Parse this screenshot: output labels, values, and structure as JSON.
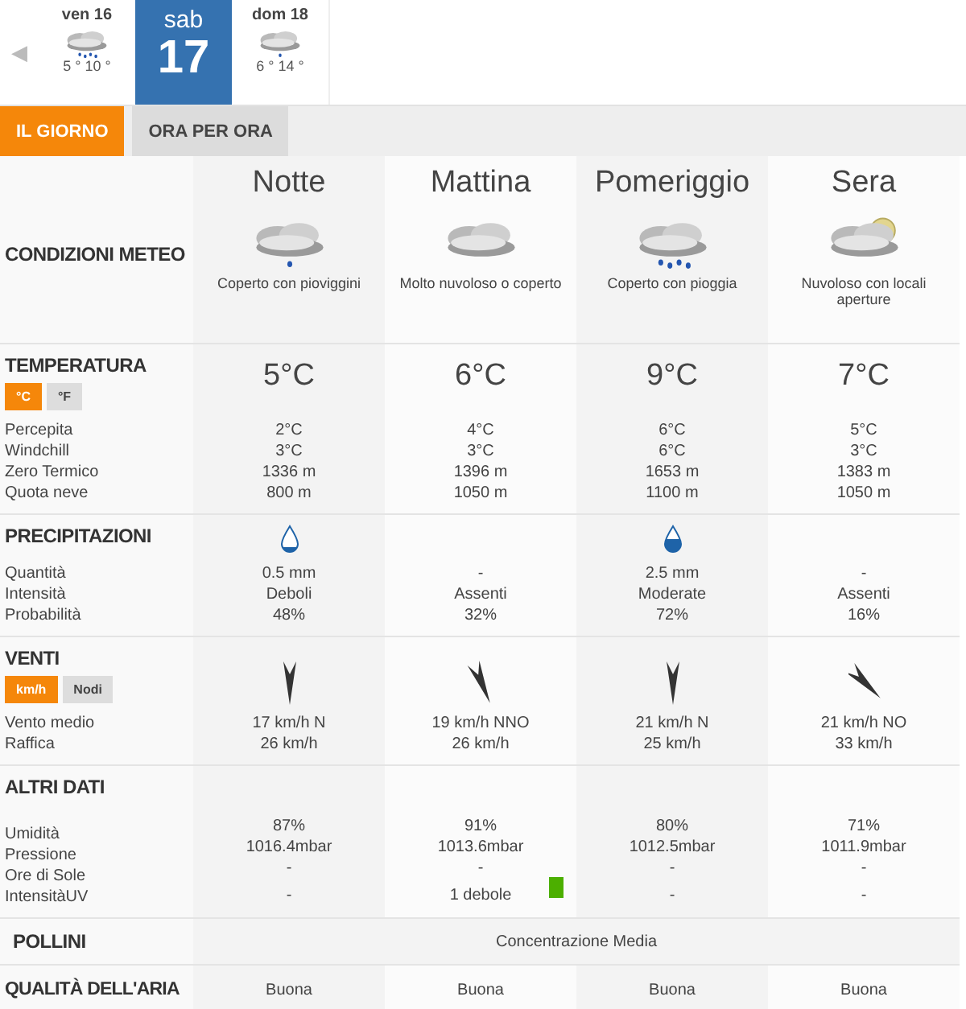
{
  "days": [
    {
      "weekday": "ven 16",
      "kind": "rain",
      "temps": "5 ° 10 °",
      "selected": false
    },
    {
      "weekday": "sab",
      "day": "17",
      "kind": "none",
      "selected": true
    },
    {
      "weekday": "dom 18",
      "kind": "drizzle",
      "temps": "6 ° 14 °",
      "selected": false
    }
  ],
  "prev_arrow": "◀",
  "tabs": [
    {
      "label": "IL GIORNO",
      "selected": true
    },
    {
      "label": "ORA PER ORA",
      "selected": false
    }
  ],
  "conditions": {
    "title": "CONDIZIONI METEO",
    "periods": [
      {
        "name": "Notte",
        "kind": "drizzle",
        "text": "Coperto con pioviggini"
      },
      {
        "name": "Mattina",
        "kind": "cloudy",
        "text": "Molto nuvoloso o coperto"
      },
      {
        "name": "Pomeriggio",
        "kind": "rain",
        "text": "Coperto con pioggia"
      },
      {
        "name": "Sera",
        "kind": "partly_sunny",
        "text": "Nuvoloso con locali aperture"
      }
    ]
  },
  "sections": [
    {
      "kind": "temperature",
      "title": "TEMPERATURA",
      "units": [
        {
          "label": "°C",
          "selected": true
        },
        {
          "label": "°F",
          "selected": false
        }
      ],
      "headline": [
        "5°C",
        "6°C",
        "9°C",
        "7°C"
      ],
      "rows": [
        {
          "label": "Percepita",
          "values": [
            "2°C",
            "4°C",
            "6°C",
            "5°C"
          ]
        },
        {
          "label": "Windchill",
          "values": [
            "3°C",
            "3°C",
            "6°C",
            "3°C"
          ]
        },
        {
          "label": "Zero Termico",
          "values": [
            "1336 m",
            "1396 m",
            "1653 m",
            "1383 m"
          ]
        },
        {
          "label": "Quota neve",
          "values": [
            "800 m",
            "1050 m",
            "1100 m",
            "1050 m"
          ]
        }
      ]
    },
    {
      "kind": "precipitation",
      "title": "PRECIPITAZIONI",
      "drops": [
        {
          "kind": "light"
        },
        {
          "kind": "none"
        },
        {
          "kind": "heavy"
        },
        {
          "kind": "none"
        }
      ],
      "rows": [
        {
          "label": "Quantità",
          "values": [
            "0.5 mm",
            "-",
            "2.5 mm",
            "-"
          ]
        },
        {
          "label": "Intensità",
          "values": [
            "Deboli",
            "Assenti",
            "Moderate",
            "Assenti"
          ]
        },
        {
          "label": "Probabilità",
          "values": [
            "48%",
            "32%",
            "72%",
            "16%"
          ]
        }
      ]
    },
    {
      "kind": "wind",
      "title": "VENTI",
      "units": [
        {
          "label": "km/h",
          "selected": true
        },
        {
          "label": "Nodi",
          "selected": false
        }
      ],
      "arrows": [
        {
          "kind": "N"
        },
        {
          "kind": "NNW"
        },
        {
          "kind": "N"
        },
        {
          "kind": "NW"
        }
      ],
      "rows": [
        {
          "label": "Vento medio",
          "values": [
            "17 km/h  N",
            "19 km/h NNO",
            "21 km/h N",
            "21 km/h NO"
          ]
        },
        {
          "label": "Raffica",
          "values": [
            "26 km/h",
            "26 km/h",
            "25 km/h",
            "33 km/h"
          ]
        }
      ]
    },
    {
      "kind": "other",
      "title": "ALTRI DATI",
      "rows": [
        {
          "label": "Umidità",
          "values": [
            "87%",
            "91%",
            "80%",
            "71%"
          ]
        },
        {
          "label": "Pressione",
          "values": [
            "1016.4mbar",
            "1013.6mbar",
            "1012.5mbar",
            "1011.9mbar"
          ]
        },
        {
          "label": "Ore di Sole",
          "values": [
            "-",
            "-",
            "-",
            "-"
          ]
        },
        {
          "label": "IntensitàUV",
          "cells": [
            {
              "text": "-"
            },
            {
              "text": "1 debole",
              "color": "#4caf00"
            },
            {
              "text": "-"
            },
            {
              "text": "-"
            }
          ]
        }
      ]
    }
  ],
  "pollini": {
    "title": "POLLINI",
    "text": "Concentrazione Media"
  },
  "air": {
    "title": "QUALITÀ DELL'ARIA",
    "values": [
      "Buona",
      "Buona",
      "Buona",
      "Buona"
    ]
  }
}
